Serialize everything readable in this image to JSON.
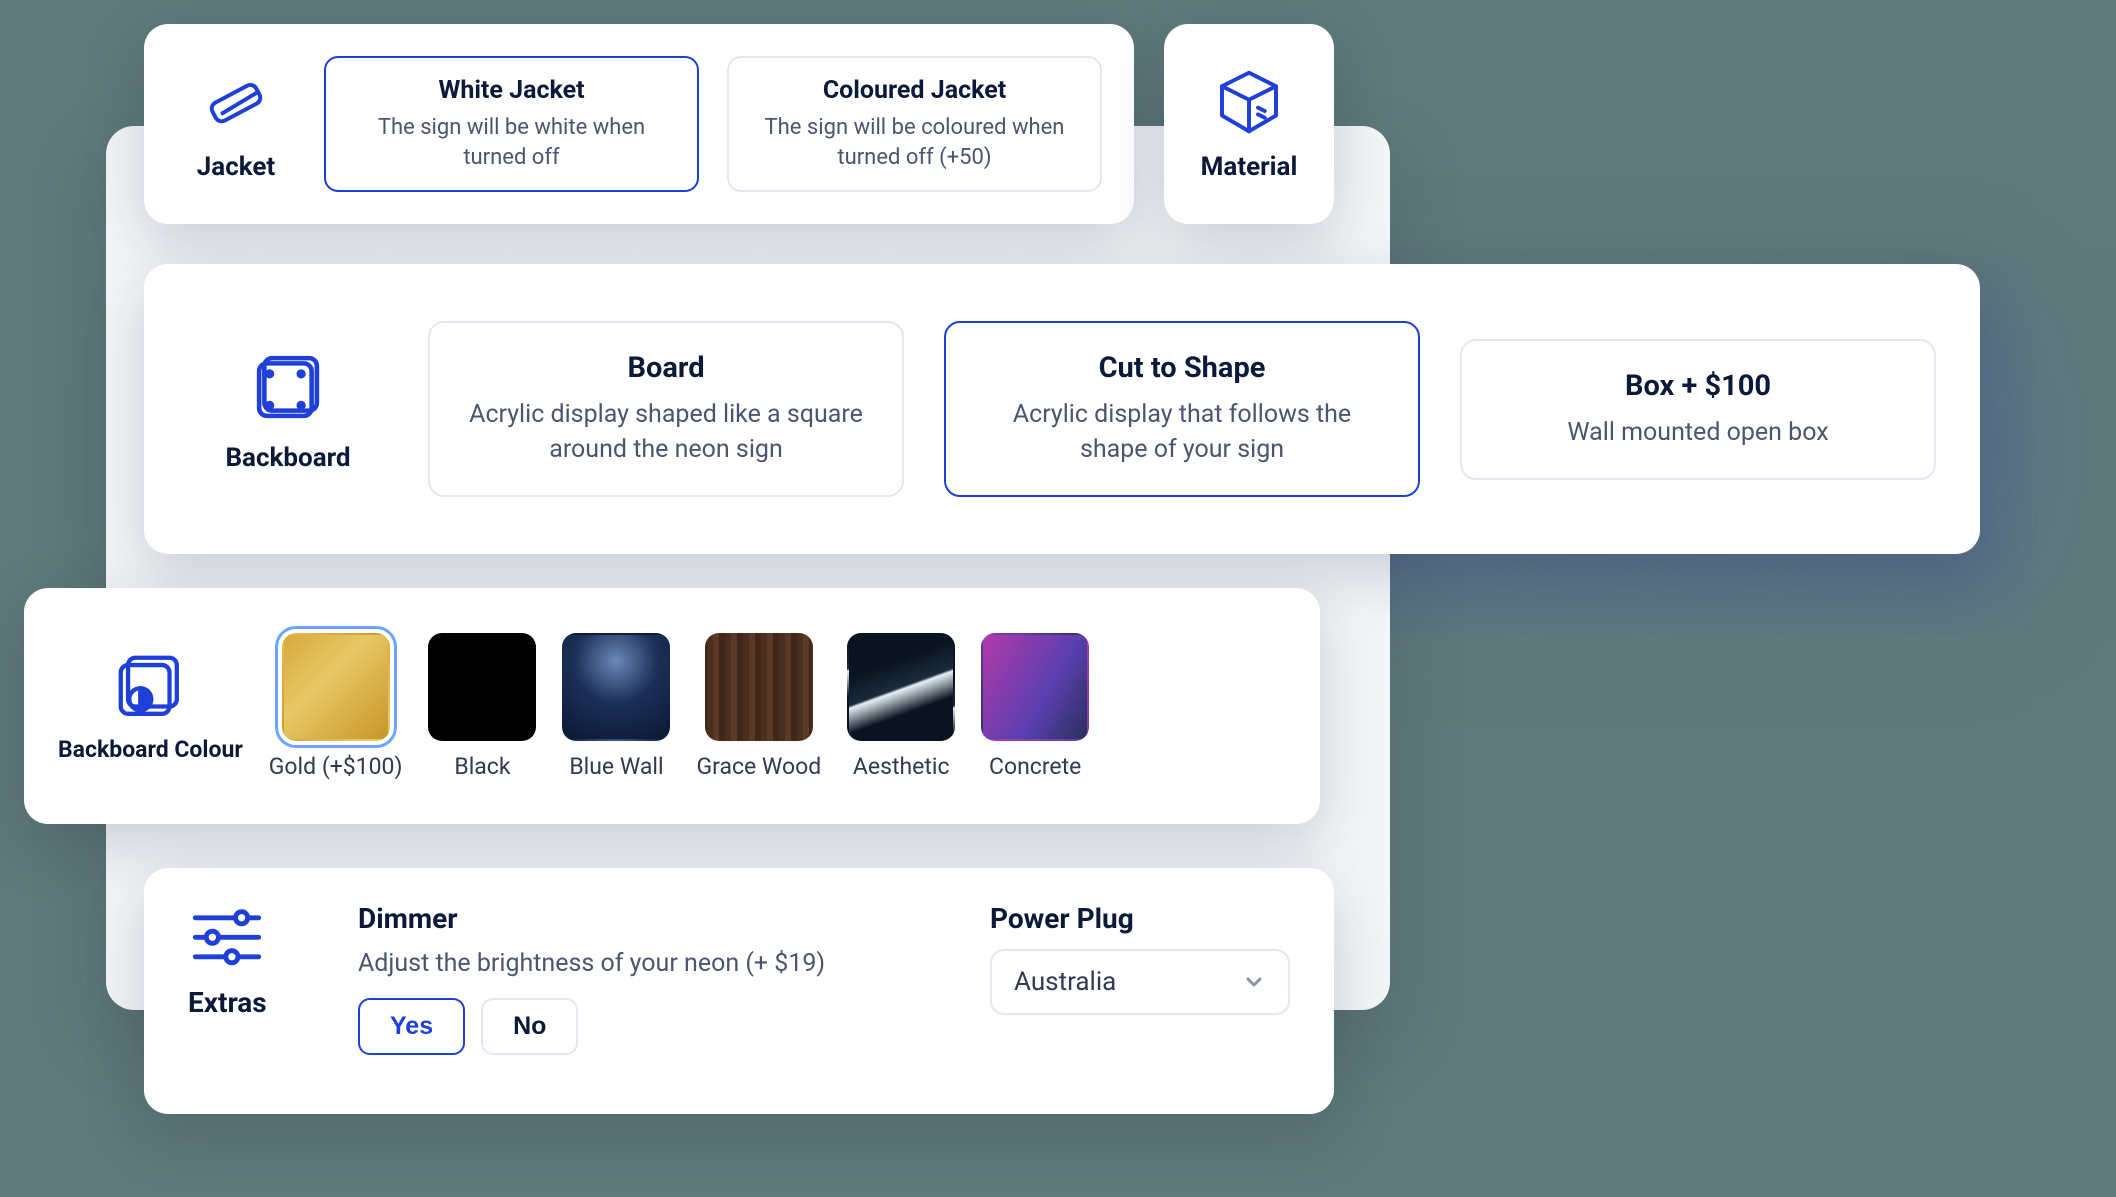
{
  "jacket": {
    "label": "Jacket",
    "options": [
      {
        "title": "White Jacket",
        "desc": "The sign will be white when turned off",
        "selected": true
      },
      {
        "title": "Coloured Jacket",
        "desc": "The sign will be coloured when turned off (+50)",
        "selected": false
      }
    ]
  },
  "material": {
    "label": "Material"
  },
  "backboard": {
    "label": "Backboard",
    "options": [
      {
        "title": "Board",
        "desc": "Acrylic display shaped like a square around the neon sign",
        "selected": false
      },
      {
        "title": "Cut to Shape",
        "desc": "Acrylic display that follows the shape of your sign",
        "selected": true
      },
      {
        "title": "Box + $100",
        "desc": "Wall mounted open box",
        "selected": false
      }
    ]
  },
  "backboard_colour": {
    "label": "Backboard Colour",
    "swatches": [
      {
        "name": "Gold (+$100)",
        "selected": true
      },
      {
        "name": "Black",
        "selected": false
      },
      {
        "name": "Blue Wall",
        "selected": false
      },
      {
        "name": "Grace Wood",
        "selected": false
      },
      {
        "name": "Aesthetic",
        "selected": false
      },
      {
        "name": "Concrete",
        "selected": false
      }
    ]
  },
  "extras": {
    "label": "Extras",
    "dimmer": {
      "title": "Dimmer",
      "desc": "Adjust the brightness of your neon (+ $19)",
      "yes": "Yes",
      "no": "No",
      "selected": "Yes"
    },
    "power_plug": {
      "title": "Power Plug",
      "value": "Australia"
    }
  }
}
